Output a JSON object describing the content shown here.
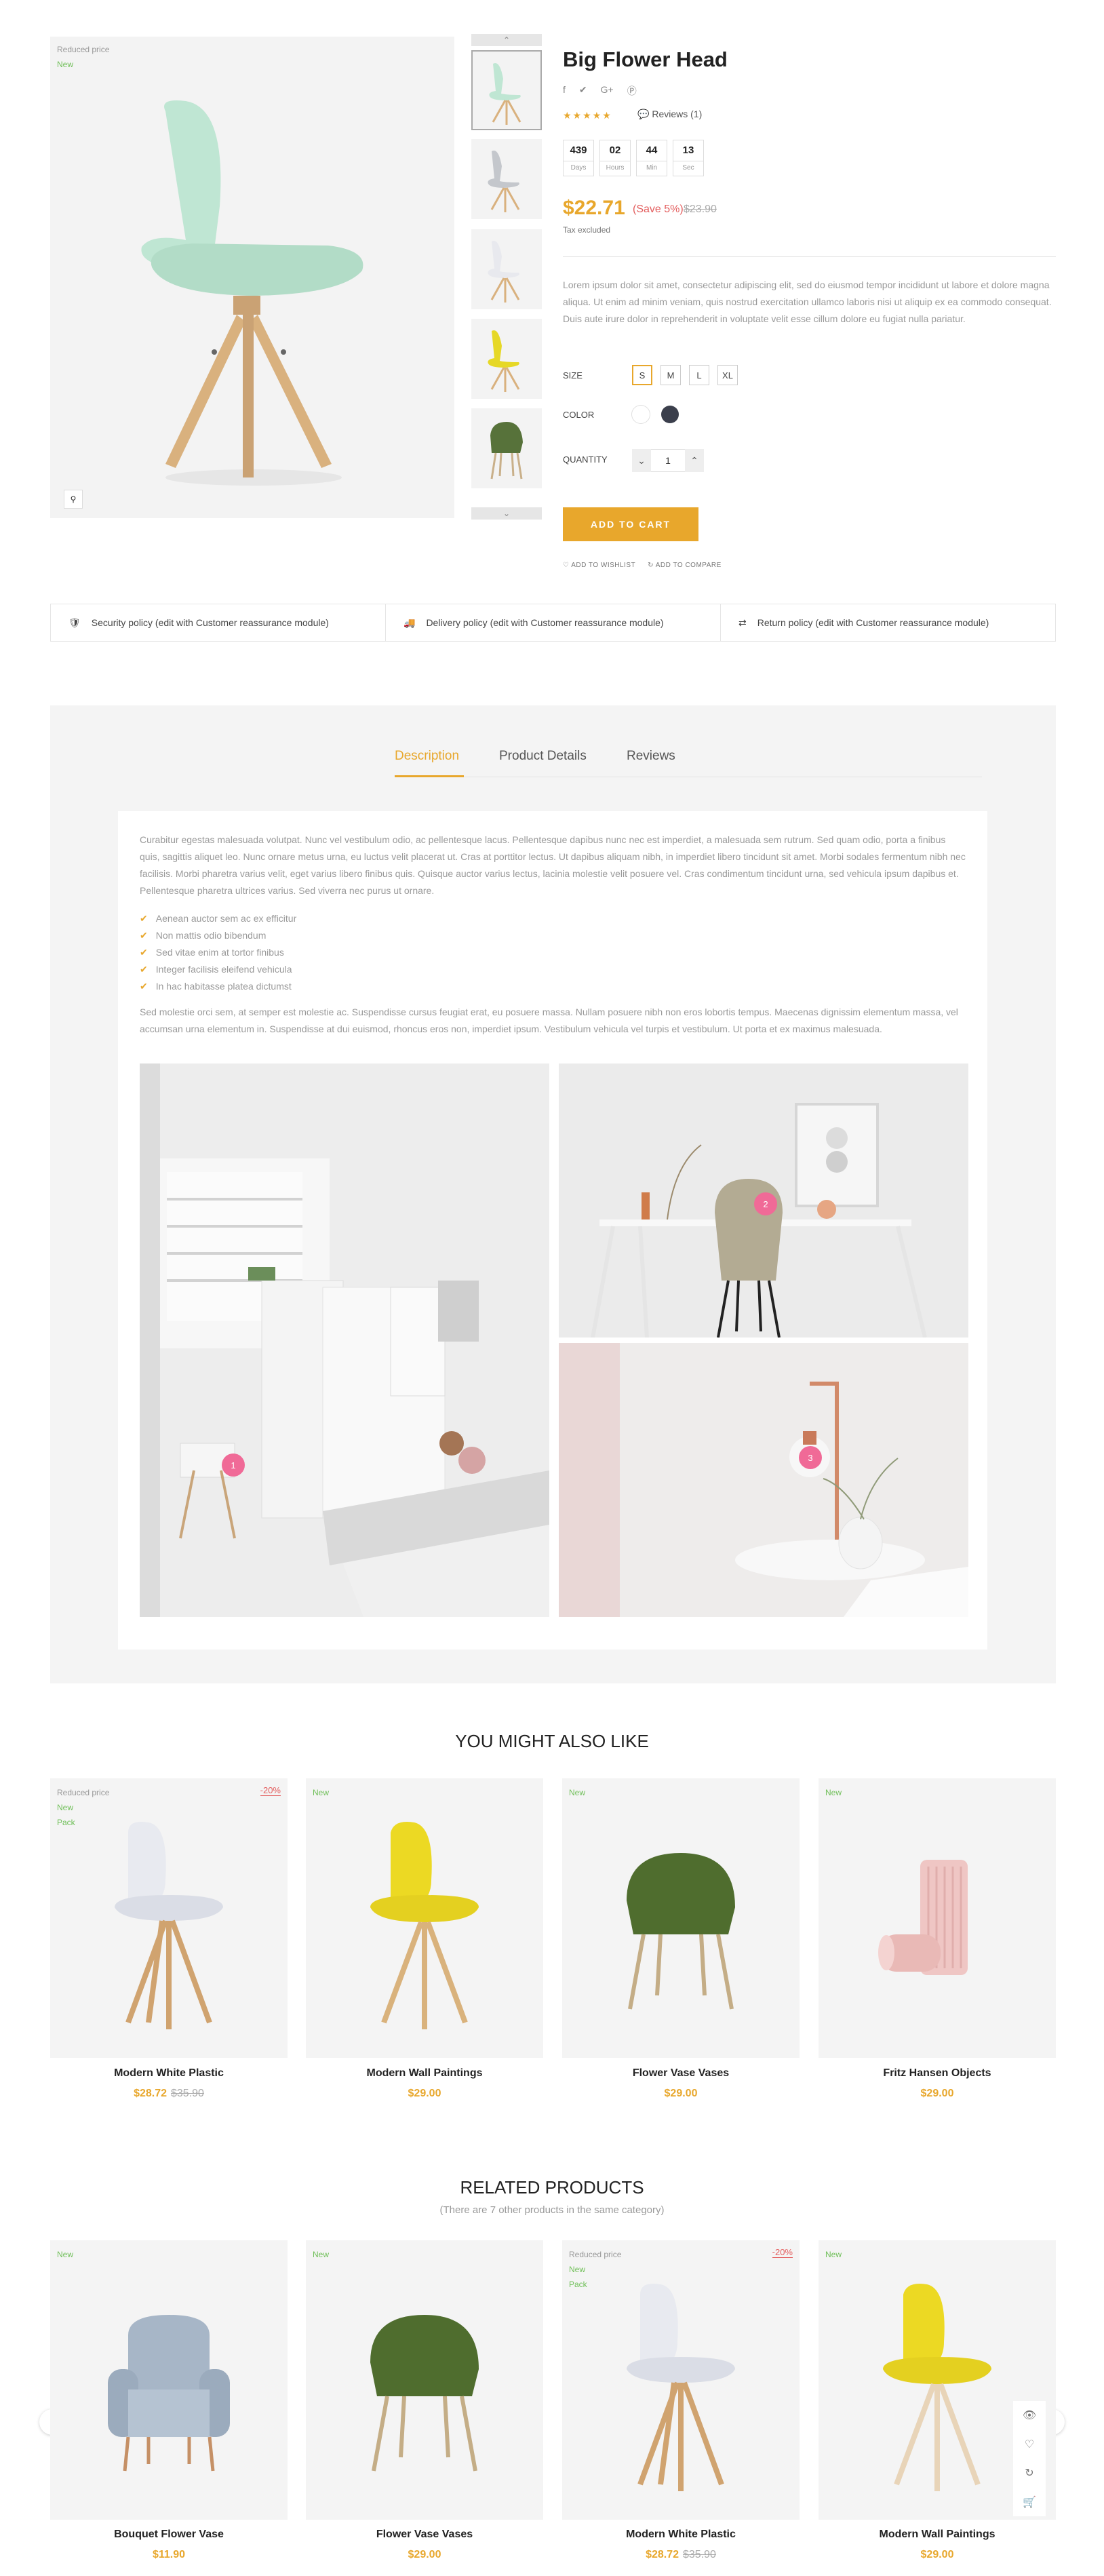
{
  "product": {
    "title": "Big Flower Head",
    "flag_reduced": "Reduced price",
    "flag_new": "New",
    "reviews_label": "Reviews (1)",
    "countdown": [
      {
        "value": "439",
        "label": "Days"
      },
      {
        "value": "02",
        "label": "Hours"
      },
      {
        "value": "44",
        "label": "Min"
      },
      {
        "value": "13",
        "label": "Sec"
      }
    ],
    "price": "$22.71",
    "save": "(Save 5%)",
    "old_price": "$23.90",
    "tax": "Tax excluded",
    "short_description": "Lorem ipsum dolor sit amet, consectetur adipiscing elit, sed do eiusmod tempor incididunt ut labore et dolore magna aliqua. Ut enim ad minim veniam, quis nostrud exercitation ullamco laboris nisi ut aliquip ex ea commodo consequat. Duis aute irure dolor in reprehenderit in voluptate velit esse cillum dolore eu fugiat nulla pariatur.",
    "size_label": "SIZE",
    "sizes": [
      "S",
      "M",
      "L",
      "XL"
    ],
    "color_label": "COLOR",
    "colors": [
      "#ffffff",
      "#3b3f4c"
    ],
    "quantity_label": "QUANTITY",
    "quantity": "1",
    "add_to_cart": "ADD TO CART",
    "wishlist": "ADD TO WISHLIST",
    "compare": "ADD TO COMPARE"
  },
  "reassurance": [
    "Security policy (edit with Customer reassurance module)",
    "Delivery policy (edit with Customer reassurance module)",
    "Return policy (edit with Customer reassurance module)"
  ],
  "tabs": [
    "Description",
    "Product Details",
    "Reviews"
  ],
  "description": {
    "para1": "Curabitur egestas malesuada volutpat. Nunc vel vestibulum odio, ac pellentesque lacus. Pellentesque dapibus nunc nec est imperdiet, a malesuada sem rutrum. Sed quam odio, porta a finibus quis, sagittis aliquet leo. Nunc ornare metus urna, eu luctus velit placerat ut. Cras at porttitor lectus. Ut dapibus aliquam nibh, in imperdiet libero tincidunt sit amet. Morbi sodales fermentum nibh nec facilisis. Morbi pharetra varius velit, eget varius libero finibus quis. Quisque auctor varius lectus, lacinia molestie velit posuere vel. Cras condimentum tincidunt urna, sed vehicula ipsum dapibus et. Pellentesque pharetra ultrices varius. Sed viverra nec purus ut ornare.",
    "checks": [
      "Aenean auctor sem ac ex efficitur",
      "Non mattis odio bibendum",
      "Sed vitae enim at tortor finibus",
      "Integer facilisis eleifend vehicula",
      "In hac habitasse platea dictumst"
    ],
    "para2": "Sed molestie orci sem, at semper est molestie ac. Suspendisse cursus feugiat erat, eu posuere massa. Nullam posuere nibh non eros lobortis tempus. Maecenas dignissim elementum massa, vel accumsan urna elementum in. Suspendisse at dui euismod, rhoncus eros non, imperdiet ipsum. Vestibulum vehicula vel turpis et vestibulum. Ut porta et ex maximus malesuada.",
    "hotspots": [
      "1",
      "2",
      "3"
    ]
  },
  "might_like": {
    "title": "YOU MIGHT ALSO LIKE",
    "items": [
      {
        "name": "Modern White Plastic",
        "price": "$28.72",
        "old": "$35.90",
        "flags": [
          "Reduced price",
          "New",
          "Pack"
        ],
        "discount": "-20%"
      },
      {
        "name": "Modern Wall Paintings",
        "price": "$29.00",
        "old": "",
        "flags": [
          "New"
        ],
        "discount": ""
      },
      {
        "name": "Flower Vase Vases",
        "price": "$29.00",
        "old": "",
        "flags": [
          "New"
        ],
        "discount": ""
      },
      {
        "name": "Fritz Hansen Objects",
        "price": "$29.00",
        "old": "",
        "flags": [
          "New"
        ],
        "discount": ""
      }
    ]
  },
  "related": {
    "title": "RELATED PRODUCTS",
    "subtitle": "(There are 7 other products in the same category)",
    "items": [
      {
        "name": "Bouquet Flower Vase",
        "price": "$11.90",
        "old": "",
        "flags": [
          "New"
        ],
        "discount": ""
      },
      {
        "name": "Flower Vase Vases",
        "price": "$29.00",
        "old": "",
        "flags": [
          "New"
        ],
        "discount": ""
      },
      {
        "name": "Modern White Plastic",
        "price": "$28.72",
        "old": "$35.90",
        "flags": [
          "Reduced price",
          "New",
          "Pack"
        ],
        "discount": "-20%"
      },
      {
        "name": "Modern Wall Paintings",
        "price": "$29.00",
        "old": "",
        "flags": [
          "New"
        ],
        "discount": ""
      }
    ]
  },
  "colors": {
    "accent": "#e8a72c",
    "discount": "#e35d5d",
    "new_flag": "#6fbf58",
    "hotspot": "#f06a97"
  }
}
